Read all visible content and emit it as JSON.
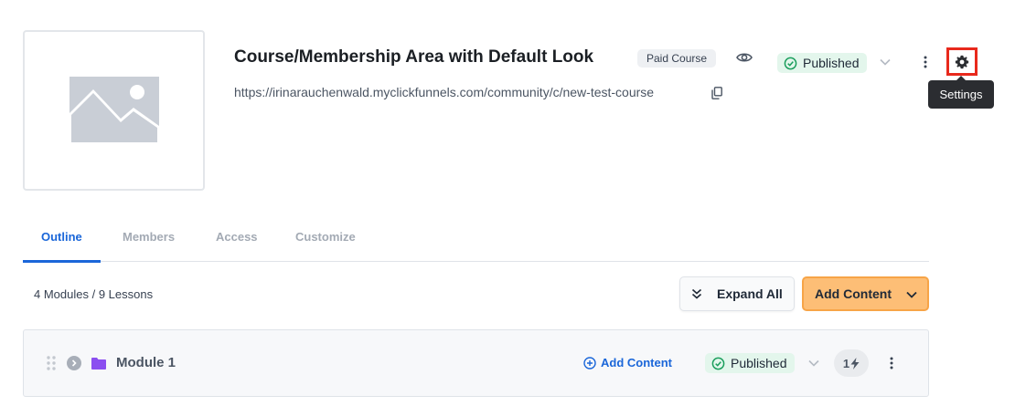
{
  "course": {
    "title": "Course/Membership Area with Default Look",
    "badge": "Paid Course",
    "url": "https://irinarauchenwald.myclickfunnels.com/community/c/new-test-course",
    "status": "Published"
  },
  "settings": {
    "tooltip": "Settings"
  },
  "tabs": [
    {
      "label": "Outline",
      "active": true
    },
    {
      "label": "Members",
      "active": false
    },
    {
      "label": "Access",
      "active": false
    },
    {
      "label": "Customize",
      "active": false
    }
  ],
  "outline": {
    "counts": "4 Modules / 9 Lessons",
    "expand_label": "Expand All",
    "add_label": "Add Content"
  },
  "modules": [
    {
      "title": "Module 1",
      "add_label": "Add Content",
      "status": "Published",
      "trigger_count": "1"
    }
  ],
  "icons": {
    "thumbnail": "image-placeholder-icon",
    "preview": "eye-icon",
    "status": "check-circle-icon",
    "caret": "chevron-down-icon",
    "menu": "kebab-menu-icon",
    "settings": "gear-icon",
    "copy": "copy-icon",
    "expand": "double-chevron-icon",
    "drag": "drag-handle-icon",
    "module_toggle": "chevron-right-circle-icon",
    "folder": "folder-icon",
    "add": "plus-circle-icon",
    "trigger": "lightning-icon"
  },
  "colors": {
    "accent": "#1a66d9",
    "primary_button": "#fdbe76",
    "published_bg": "#e3f6ec",
    "published_icon": "#1a9e5c",
    "highlight_border": "#e8291c",
    "folder": "#8b4ef0"
  }
}
